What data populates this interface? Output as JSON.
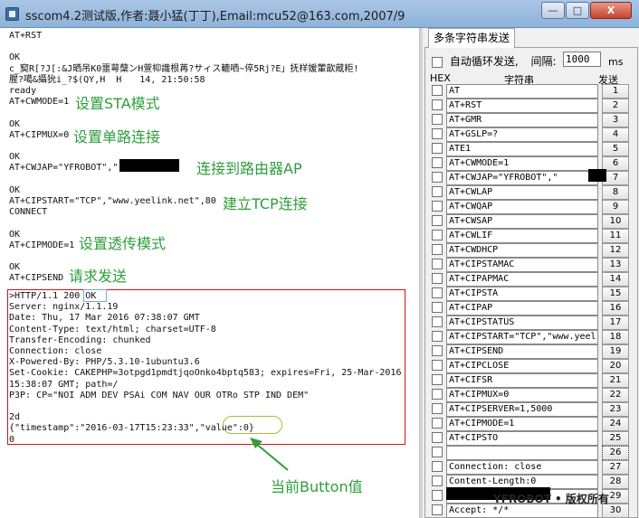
{
  "window": {
    "title": "sscom4.2测试版,作者:聂小猛(丁丁),Email:mcu52@163.com,2007/9",
    "min_label": "—",
    "max_label": "□",
    "close_label": "X"
  },
  "receive": {
    "lines": [
      "AT+RST",
      "",
      "OK",
      "c_窫R[?J[:&J晒吊K0噩萼蘖ンH萱枊識根苒?サィス轆哂~倅5Rj?E」抚样媛葷歆蔵粔!",
      "腥?噶&攝狁i_?$(QY,H  H　　14, 21:50:58",
      "ready",
      "AT+CWMODE=1",
      "",
      "OK",
      "AT+CIPMUX=0",
      "",
      "OK",
      "AT+CWJAP=\"YFROBOT\",\"",
      "",
      "OK",
      "AT+CIPSTART=\"TCP\",\"www.yeelink.net\",80",
      "CONNECT",
      "",
      "OK",
      "AT+CIPMODE=1",
      "",
      "OK",
      "AT+CIPSEND"
    ],
    "http_lines": [
      ">HTTP/1.1 200 OK",
      "Server: nginx/1.1.19",
      "Date: Thu, 17 Mar 2016 07:38:07 GMT",
      "Content-Type: text/html; charset=UTF-8",
      "Transfer-Encoding: chunked",
      "Connection: close",
      "X-Powered-By: PHP/5.3.10-1ubuntu3.6",
      "Set-Cookie: CAKEPHP=3otpgd1pmdtjqoOnko4bptq583; expires=Fri, 25-Mar-2016",
      "15:38:07 GMT; path=/",
      "P3P: CP=\"NOI ADM DEV PSAi COM NAV OUR OTRo STP IND DEM\"",
      "",
      "2d",
      "{\"timestamp\":\"2016-03-17T15:23:33\",\"value\":0}",
      "0"
    ],
    "annotations": {
      "sta_mode": "设置STA模式",
      "single_conn": "设置单路连接",
      "connect_ap": "连接到路由器AP",
      "tcp_conn": "建立TCP连接",
      "passthrough": "设置透传模式",
      "request_send": "请求发送",
      "button_value": "当前Button值"
    },
    "annotation_color": "#2e9e3b"
  },
  "panel": {
    "tab_label": "多条字符串发送",
    "loop_label": "自动循环发送,",
    "interval_label": "间隔:",
    "interval_value": "1000",
    "interval_unit": "ms",
    "col_hex": "HEX",
    "col_string": "字符串",
    "col_send": "发送",
    "rows": [
      {
        "text": "AT",
        "btn": "1"
      },
      {
        "text": "AT+RST",
        "btn": "2"
      },
      {
        "text": "AT+GMR",
        "btn": "3"
      },
      {
        "text": "AT+GSLP=?",
        "btn": "4"
      },
      {
        "text": "ATE1",
        "btn": "5"
      },
      {
        "text": "AT+CWMODE=1",
        "btn": "6"
      },
      {
        "text": "AT+CWJAP=\"YFROBOT\",\"",
        "btn": "7"
      },
      {
        "text": "AT+CWLAP",
        "btn": "8"
      },
      {
        "text": "AT+CWQAP",
        "btn": "9"
      },
      {
        "text": "AT+CWSAP",
        "btn": "10"
      },
      {
        "text": "AT+CWLIF",
        "btn": "11"
      },
      {
        "text": "AT+CWDHCP",
        "btn": "12"
      },
      {
        "text": "AT+CIPSTAMAC",
        "btn": "13"
      },
      {
        "text": "AT+CIPAPMAC",
        "btn": "14"
      },
      {
        "text": "AT+CIPSTA",
        "btn": "15"
      },
      {
        "text": "AT+CIPAP",
        "btn": "16"
      },
      {
        "text": "AT+CIPSTATUS",
        "btn": "17"
      },
      {
        "text": "AT+CIPSTART=\"TCP\",\"www.yeel",
        "btn": "18"
      },
      {
        "text": "AT+CIPSEND",
        "btn": "19"
      },
      {
        "text": "AT+CIPCLOSE",
        "btn": "20"
      },
      {
        "text": "AT+CIFSR",
        "btn": "21"
      },
      {
        "text": "AT+CIPMUX=0",
        "btn": "22"
      },
      {
        "text": "AT+CIPSERVER=1,5000",
        "btn": "23"
      },
      {
        "text": "AT+CIPMODE=1",
        "btn": "24"
      },
      {
        "text": "AT+CIPSTO",
        "btn": "25"
      },
      {
        "text": "",
        "btn": "26"
      },
      {
        "text": "Connection: close",
        "btn": "27"
      },
      {
        "text": "Content-Length:0",
        "btn": "28"
      },
      {
        "text": "",
        "btn": "29"
      },
      {
        "text": "Accept: */*",
        "btn": "30"
      }
    ],
    "watermark": "YFROBOT • 版权所有"
  }
}
